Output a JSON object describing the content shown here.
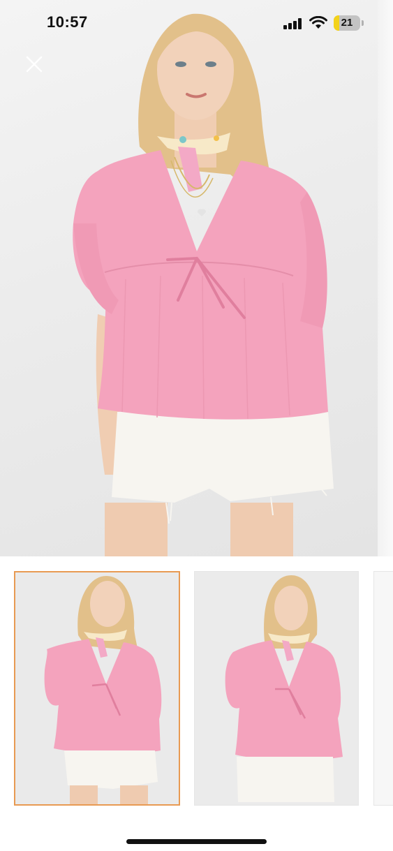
{
  "status_bar": {
    "time": "10:57",
    "battery_level": "21",
    "icons": [
      "signal-icon",
      "wifi-icon",
      "battery-icon"
    ]
  },
  "toolbar": {
    "close_icon": "close-icon"
  },
  "gallery": {
    "main_image": "product-photo-pink-blouse-front",
    "thumbnails": [
      {
        "image": "product-photo-pink-blouse-front",
        "selected": true
      },
      {
        "image": "product-photo-pink-blouse-front-2",
        "selected": false
      },
      {
        "image": "product-photo-partial",
        "selected": false
      }
    ]
  },
  "colors": {
    "selected_border": "#e89a52",
    "blouse": "#f4a3bd",
    "shorts": "#f7f5f0"
  }
}
